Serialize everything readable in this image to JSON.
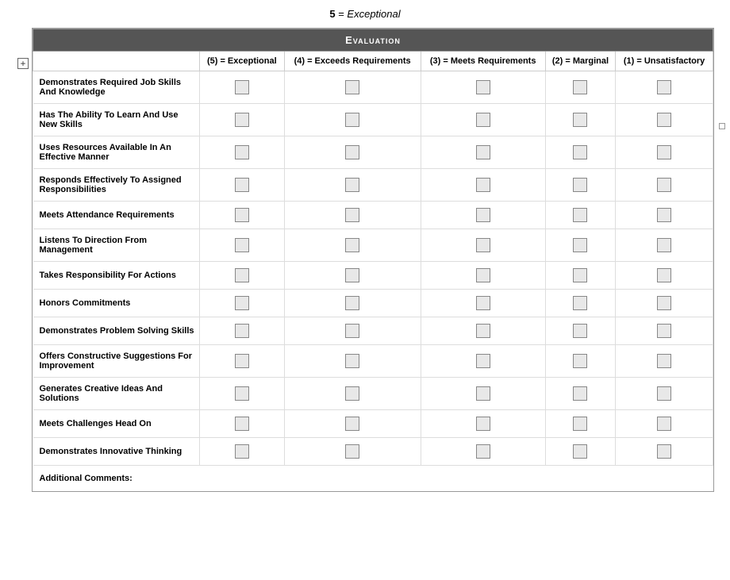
{
  "header": {
    "rating_label": "5",
    "rating_text": "Exceptional"
  },
  "table": {
    "section_title": "Evaluation",
    "columns": [
      {
        "id": "col-criteria",
        "label": ""
      },
      {
        "id": "col-5",
        "label": "(5) = Exceptional"
      },
      {
        "id": "col-4",
        "label": "(4) = Exceeds Requirements"
      },
      {
        "id": "col-3",
        "label": "(3) = Meets Requirements"
      },
      {
        "id": "col-2",
        "label": "(2) = Marginal"
      },
      {
        "id": "col-1",
        "label": "(1) = Unsatisfactory"
      }
    ],
    "rows": [
      {
        "id": "row-1",
        "label": "Demonstrates Required Job Skills And Knowledge"
      },
      {
        "id": "row-2",
        "label": "Has The Ability To Learn And Use New Skills"
      },
      {
        "id": "row-3",
        "label": "Uses Resources Available In An Effective Manner"
      },
      {
        "id": "row-4",
        "label": "Responds Effectively To Assigned Responsibilities"
      },
      {
        "id": "row-5",
        "label": "Meets Attendance Requirements"
      },
      {
        "id": "row-6",
        "label": "Listens To Direction From Management"
      },
      {
        "id": "row-7",
        "label": "Takes Responsibility For Actions"
      },
      {
        "id": "row-8",
        "label": "Honors Commitments"
      },
      {
        "id": "row-9",
        "label": "Demonstrates Problem Solving Skills"
      },
      {
        "id": "row-10",
        "label": "Offers Constructive Suggestions For Improvement"
      },
      {
        "id": "row-11",
        "label": "Generates Creative Ideas And Solutions"
      },
      {
        "id": "row-12",
        "label": "Meets Challenges Head On"
      },
      {
        "id": "row-13",
        "label": "Demonstrates Innovative Thinking"
      }
    ],
    "footer_label": "Additional Comments:"
  }
}
